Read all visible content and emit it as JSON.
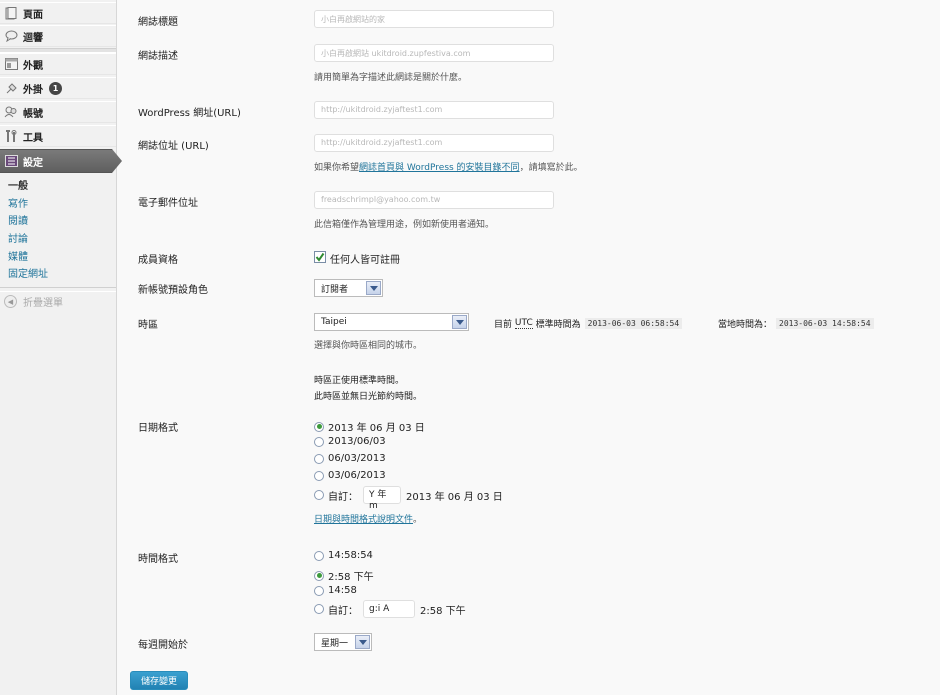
{
  "sidebar": {
    "items": [
      {
        "label": "頁面",
        "icon": "page-icon"
      },
      {
        "label": "迴響",
        "icon": "comment-icon"
      },
      {
        "label": "外觀",
        "icon": "appearance-icon"
      },
      {
        "label": "外掛",
        "icon": "plugin-icon",
        "badge": "1"
      },
      {
        "label": "帳號",
        "icon": "users-icon"
      },
      {
        "label": "工具",
        "icon": "tools-icon"
      },
      {
        "label": "設定",
        "icon": "settings-icon"
      }
    ],
    "submenu": [
      "一般",
      "寫作",
      "閱讀",
      "討論",
      "媒體",
      "固定網址"
    ],
    "collapse_label": "折疊選單"
  },
  "form": {
    "site_title": {
      "label": "網誌標題",
      "value": "小白再啟網站的家"
    },
    "tagline": {
      "label": "網誌描述",
      "value": "小白再啟網站    ukitdroid.zupfestiva.com",
      "desc": "請用簡單為字描述此網誌是關於什麼。"
    },
    "wp_url": {
      "label": "WordPress 網址(URL)",
      "value": "http://ukitdroid.zyjaftest1.com"
    },
    "site_url": {
      "label": "網誌位址 (URL)",
      "value": "http://ukitdroid.zyjaftest1.com",
      "desc_before": "如果你希望",
      "desc_link": "網誌首頁與 WordPress 的安裝目錄不同",
      "desc_after": "，請填寫於此。"
    },
    "email": {
      "label": "電子郵件位址",
      "value": "freadschrimpl@yahoo.com.tw",
      "desc": "此信箱僅作為管理用途，例如新使用者通知。"
    },
    "membership": {
      "label": "成員資格",
      "checkbox_label": "任何人皆可註冊",
      "checked": true
    },
    "default_role": {
      "label": "新帳號預設角色",
      "value": "訂閱者"
    },
    "timezone": {
      "label": "時區",
      "value": "Taipei",
      "utc_prefix": "目前",
      "utc_abbr": "UTC",
      "utc_suffix": "標準時間為",
      "utc_time": "2013-06-03 06:58:54",
      "local_label": "當地時間為：",
      "local_time": "2013-06-03 14:58:54",
      "desc": "選擇與你時區相同的城市。",
      "note1": "時區正使用標準時間。",
      "note2": "此時區並無日光節約時間。"
    },
    "date_format": {
      "label": "日期格式",
      "options": [
        "2013 年 06 月 03 日",
        "2013/06/03",
        "06/03/2013",
        "03/06/2013"
      ],
      "selected": 0,
      "custom_label": "自訂：",
      "custom_value": "Y 年 m",
      "custom_preview": "2013 年 06 月 03 日",
      "doc_link": "日期與時間格式說明文件"
    },
    "time_format": {
      "label": "時間格式",
      "options": [
        "14:58:54",
        "2:58 下午",
        "14:58"
      ],
      "selected": 1,
      "custom_label": "自訂：",
      "custom_value": "g:i A",
      "custom_preview": "2:58 下午"
    },
    "week_start": {
      "label": "每週開始於",
      "value": "星期一"
    },
    "save_label": "儲存變更"
  }
}
